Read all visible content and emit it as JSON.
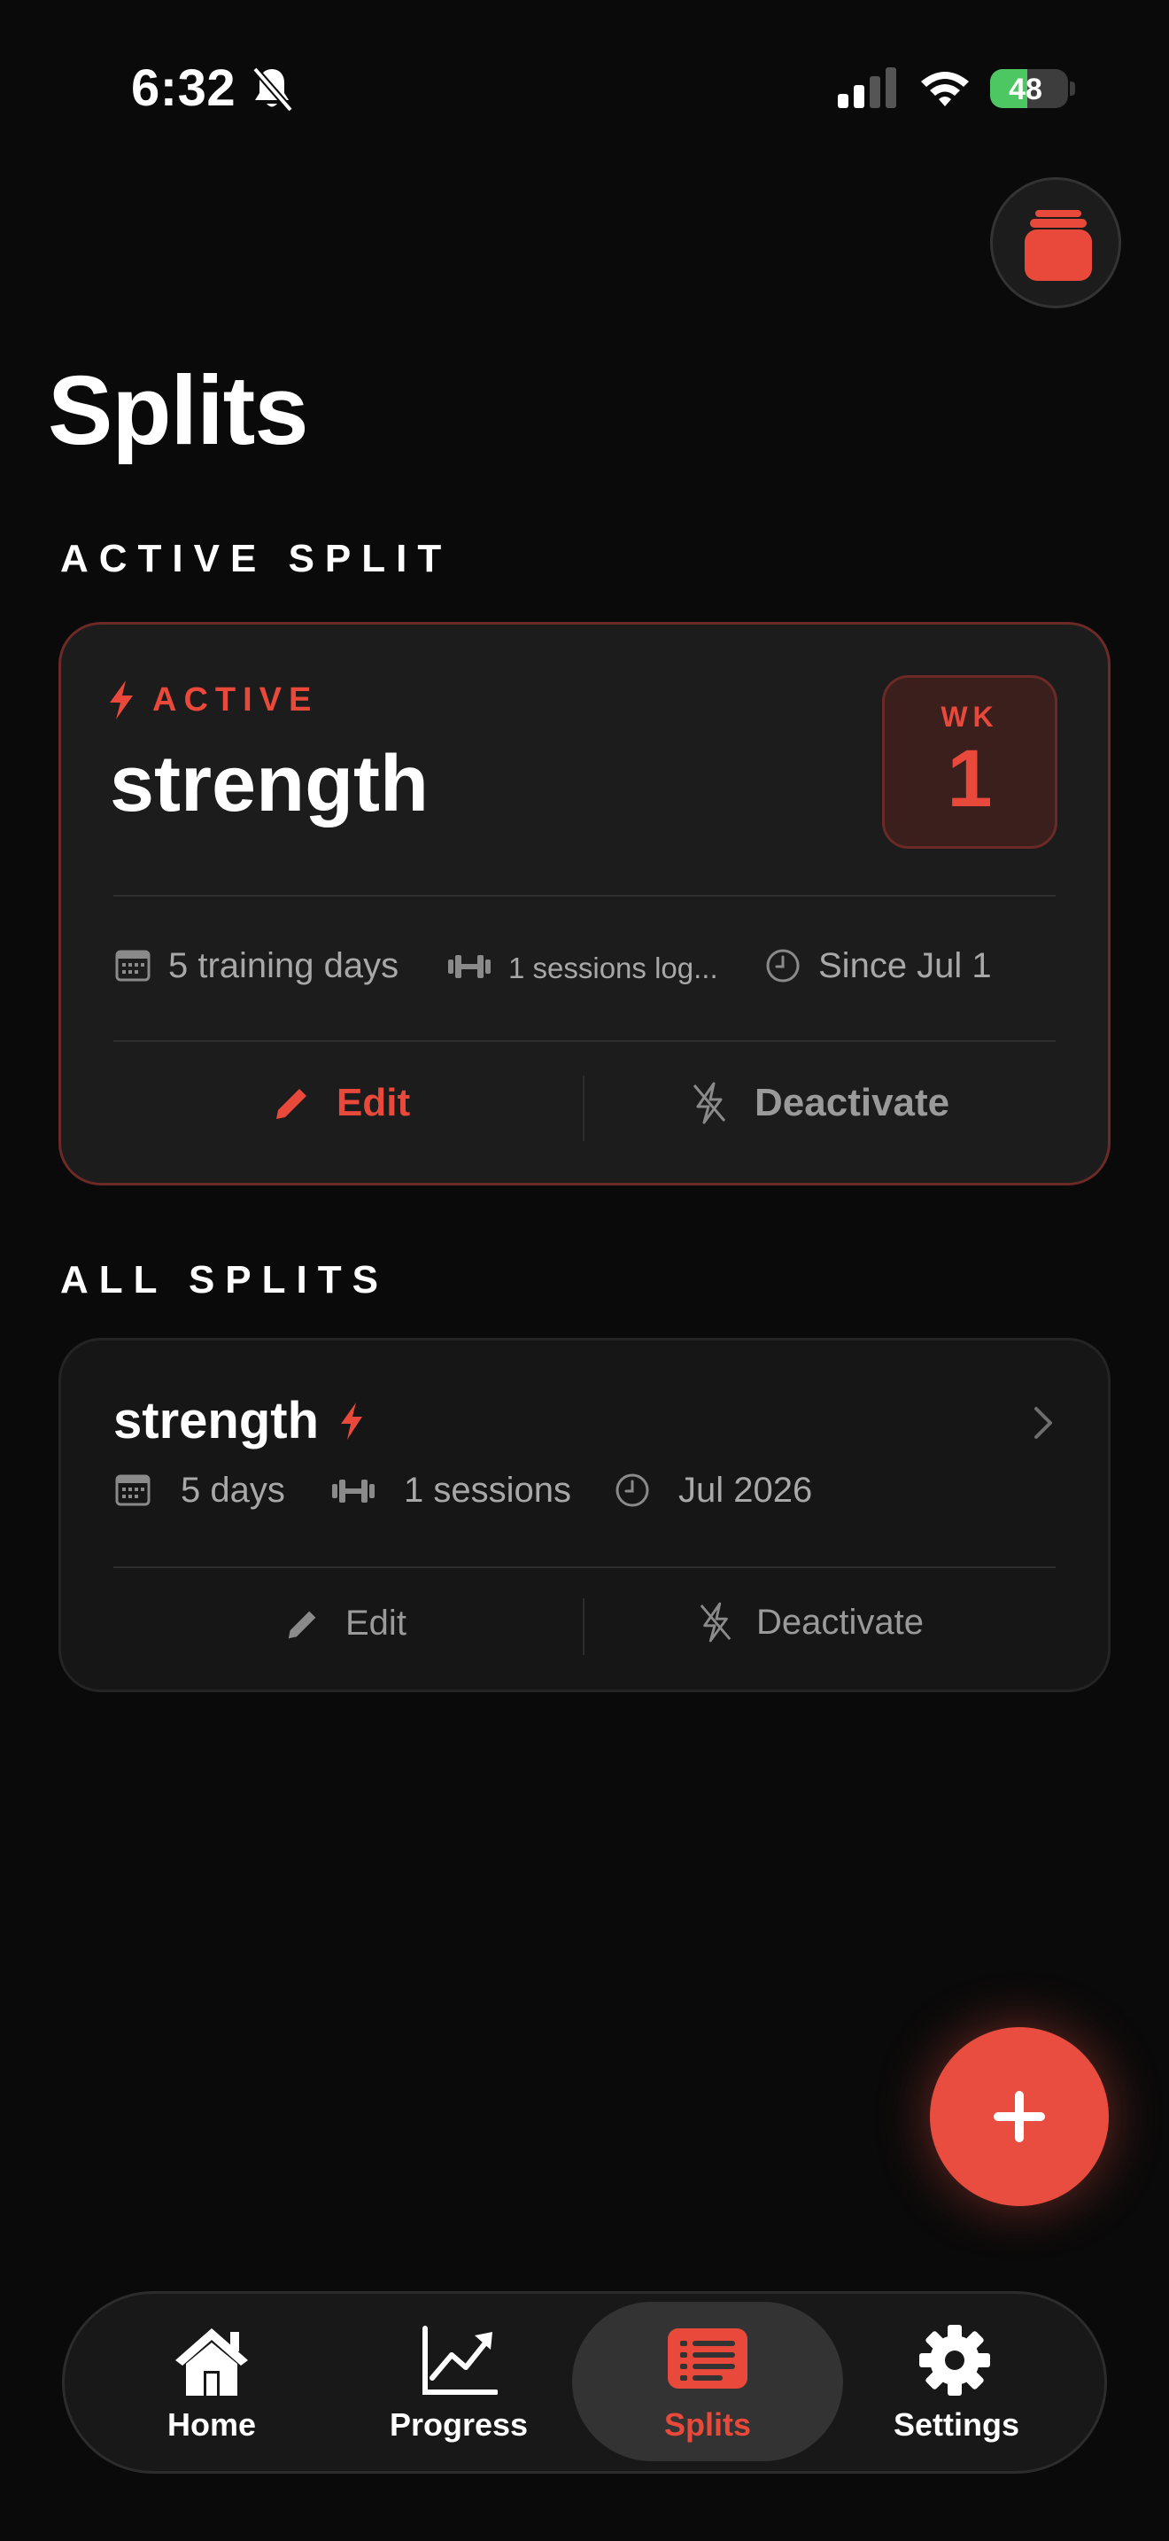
{
  "status_bar": {
    "time": "6:32",
    "battery_text": "48",
    "battery_level_percent": 48,
    "icons": [
      "bell-slash-icon",
      "cellular-signal-icon",
      "wifi-icon",
      "battery-charging-icon"
    ]
  },
  "header": {
    "title": "Splits",
    "top_button_icon": "layers-stack-icon"
  },
  "active_section": {
    "label": "ACTIVE SPLIT",
    "card": {
      "status_tag": "ACTIVE",
      "name": "strength",
      "week_label": "WK",
      "week_number": "1",
      "meta": {
        "training_days": "5 training days",
        "sessions": "1 sessions log...",
        "since": "Since Jul 1"
      },
      "actions": {
        "edit": "Edit",
        "deactivate": "Deactivate"
      }
    }
  },
  "all_section": {
    "label": "ALL SPLITS",
    "items": [
      {
        "name": "strength",
        "days": "5 days",
        "sessions": "1 sessions",
        "date": "Jul 2026",
        "actions": {
          "edit": "Edit",
          "deactivate": "Deactivate"
        }
      }
    ]
  },
  "fab": {
    "icon": "plus-icon"
  },
  "tabbar": {
    "tabs": [
      {
        "label": "Home",
        "icon": "house-icon"
      },
      {
        "label": "Progress",
        "icon": "chart-trend-icon"
      },
      {
        "label": "Splits",
        "icon": "list-card-icon"
      },
      {
        "label": "Settings",
        "icon": "gear-icon"
      }
    ],
    "active_tab": "Splits"
  },
  "colors": {
    "accent": "#e8493b",
    "background": "#0a0a0a",
    "card": "#1c1c1c",
    "muted_text": "#a8a8a8",
    "battery_green": "#4cc762"
  }
}
